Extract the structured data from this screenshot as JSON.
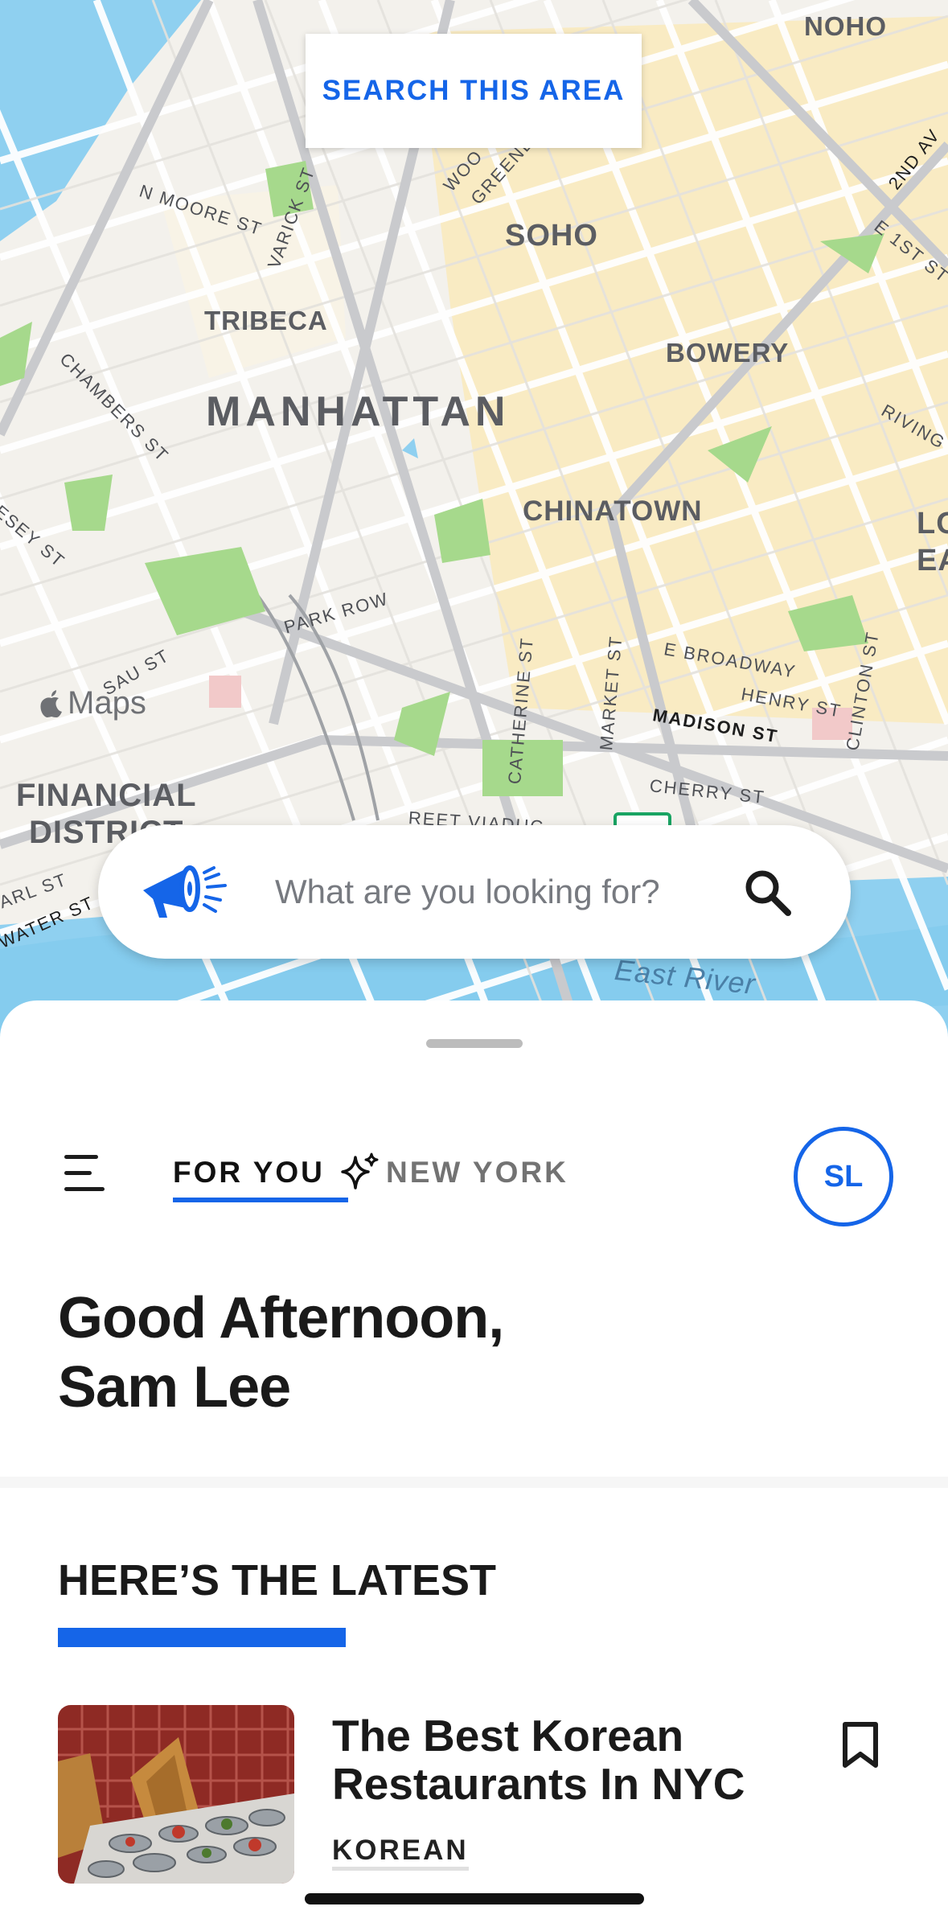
{
  "map": {
    "search_area_label": "SEARCH THIS AREA",
    "attribution": "Maps",
    "neighborhoods": {
      "noho": "NOHO",
      "soho": "SOHO",
      "tribeca": "TRIBECA",
      "manhattan": "MANHATTAN",
      "bowery": "BOWERY",
      "chinatown": "CHINATOWN",
      "lower_east": "LO\nEAS",
      "financial_district": "FINANCIAL\nDISTRICT",
      "east_river": "East River"
    },
    "streets": {
      "n_moore": "N MOORE ST",
      "varick": "VARICK ST",
      "chambers": "CHAMBERS ST",
      "vesey": "ESEY ST",
      "park_row": "PARK ROW",
      "nassau": "SAU ST",
      "catherine": "CATHERINE ST",
      "market": "MARKET ST",
      "e_broadway": "E BROADWAY",
      "henry": "HENRY ST",
      "madison": "MADISON ST",
      "clinton": "CLINTON ST",
      "cherry": "CHERRY ST",
      "second_ave": "2ND AV",
      "e_first": "E 1ST ST",
      "rivington": "RIVING",
      "greene": "GREENE",
      "wooster": "WOO",
      "water": "WATER ST",
      "pearl": "ARL ST",
      "viaduct": "REET VIADUC"
    }
  },
  "search": {
    "placeholder": "What are you looking for?"
  },
  "nav": {
    "tabs": [
      {
        "label": "FOR YOU",
        "active": true
      },
      {
        "label": "NEW YORK",
        "active": false
      }
    ],
    "avatar_initials": "SL"
  },
  "greeting": {
    "line1": "Good Afternoon,",
    "line2": "Sam Lee"
  },
  "latest": {
    "heading": "HERE’S THE LATEST",
    "articles": [
      {
        "title": "The Best Korean Restaurants In NYC",
        "tag": "KOREAN"
      }
    ]
  },
  "colors": {
    "accent": "#1565e8",
    "water": "#8fd0f0",
    "park": "#a6d98c",
    "block": "#fbe8b6"
  }
}
